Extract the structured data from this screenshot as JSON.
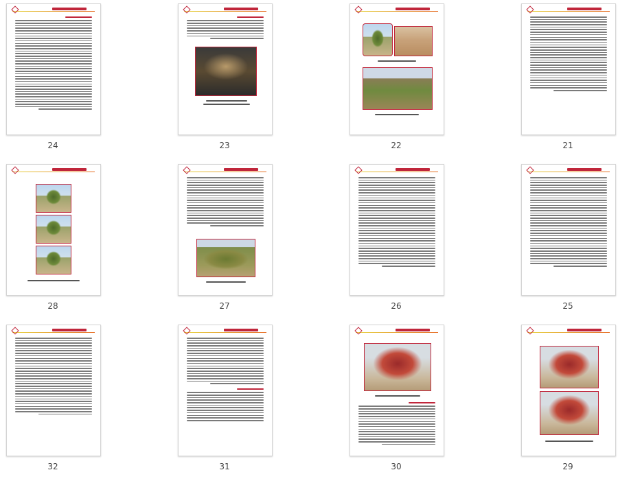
{
  "pages": [
    {
      "number": "24"
    },
    {
      "number": "23"
    },
    {
      "number": "22"
    },
    {
      "number": "21"
    },
    {
      "number": "28"
    },
    {
      "number": "27"
    },
    {
      "number": "26"
    },
    {
      "number": "25"
    },
    {
      "number": "32"
    },
    {
      "number": "31"
    },
    {
      "number": "30"
    },
    {
      "number": "29"
    }
  ],
  "colors": {
    "accent_red": "#c0263b",
    "header_yellow": "#e6d33a",
    "header_orange": "#e66a1f",
    "page_border": "#d4d4d4",
    "label_text": "#444444"
  },
  "icons": {
    "header_emblem": "diamond-emblem-icon"
  }
}
